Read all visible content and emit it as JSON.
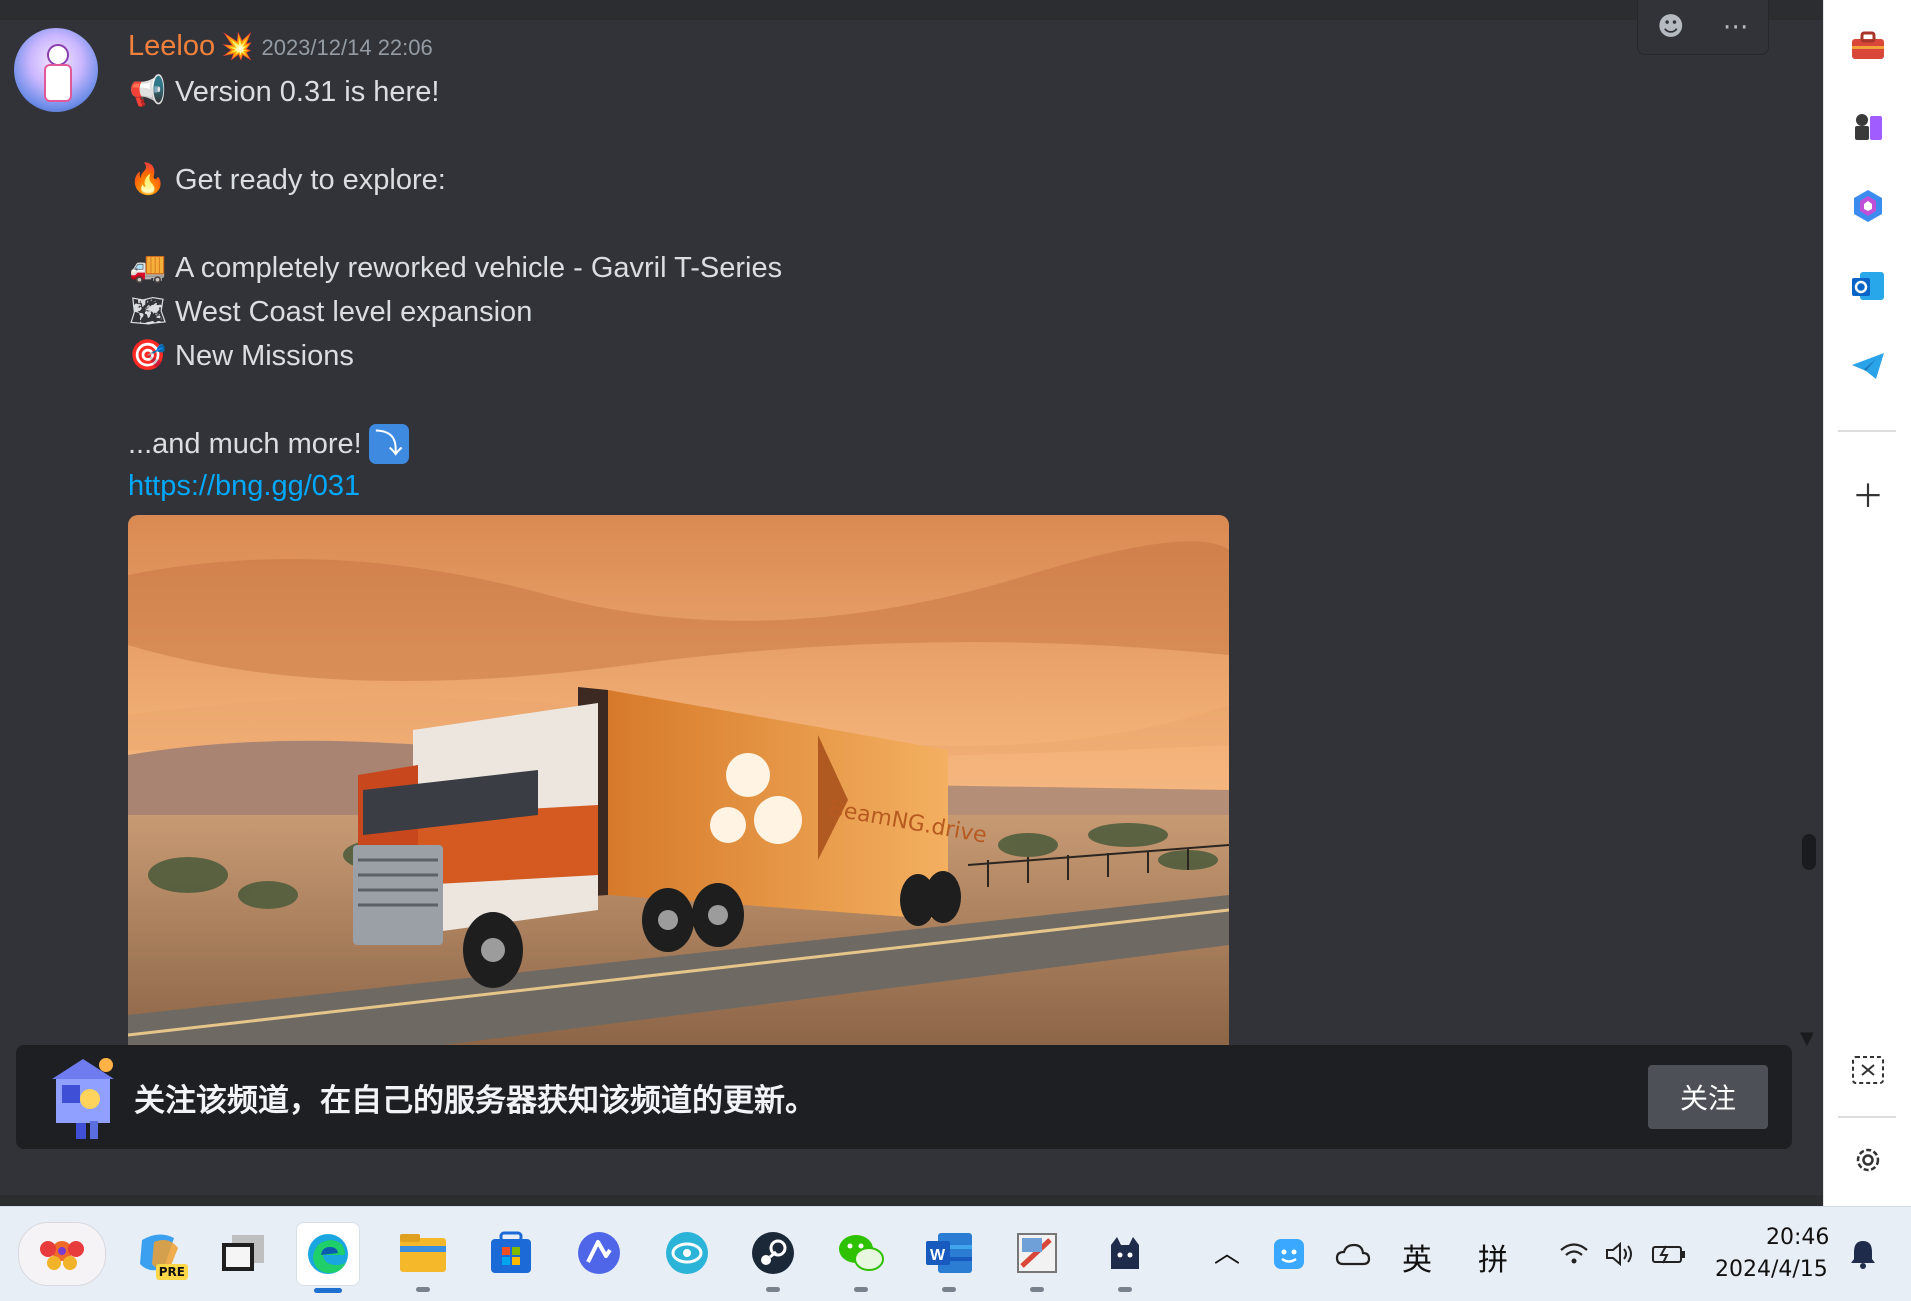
{
  "message": {
    "username": "Leeloo",
    "timestamp": "2023/12/14 22:06",
    "lines": [
      {
        "emoji": "📢",
        "text": "Version 0.31 is here!"
      },
      {
        "emoji": "🔥",
        "text": "Get ready to explore:"
      },
      {
        "emoji": "🚚",
        "text": "A completely reworked vehicle - Gavril T-Series"
      },
      {
        "emoji": "🗺",
        "text": "West Coast level expansion"
      },
      {
        "emoji": "🎯",
        "text": "New Missions"
      },
      {
        "text": "...and much more!",
        "emoji_after": "⤵"
      }
    ],
    "link": "https://bng.gg/031",
    "embed_image": "BeamNG.drive truck on desert highway at sunset",
    "embed_trailer_text": "BeamNG.drive"
  },
  "hover_toolbar": {
    "reaction_icon": "smiley-icon",
    "more_icon": "more-dots-icon"
  },
  "follow_bar": {
    "text": "关注该频道，在自己的服务器获知该频道的更新。",
    "button": "关注"
  },
  "sidebar_icons": [
    "toolbox-icon",
    "chess-icon",
    "copilot-icon",
    "outlook-icon",
    "telegram-icon",
    "add-icon",
    "screenshot-icon",
    "settings-icon"
  ],
  "taskbar": {
    "apps": [
      "flower-widget",
      "copilot-pre",
      "white-window",
      "edge",
      "file-explorer",
      "store",
      "vector-app",
      "eye-app",
      "steam",
      "wechat",
      "word",
      "paint-app",
      "cat-app"
    ],
    "pre_badge": "PRE",
    "ime_lang": "英",
    "ime_mode": "拼",
    "time": "20:46",
    "date": "2024/4/15"
  }
}
